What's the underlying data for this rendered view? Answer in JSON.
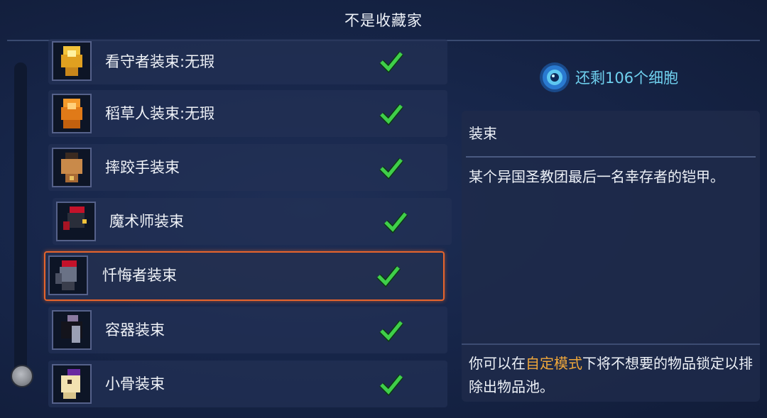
{
  "header": {
    "title": "不是收藏家"
  },
  "cells": {
    "label": "还剩106个细胞",
    "icon": "cell-orb-icon",
    "color": "#6fd0ee"
  },
  "items": [
    {
      "label": "看守者装束:无瑕",
      "icon": "gold-armor-outfit-icon",
      "checked": true
    },
    {
      "label": "稻草人装束:无瑕",
      "icon": "orange-armor-outfit-icon",
      "checked": true
    },
    {
      "label": "摔跤手装束",
      "icon": "wrestler-outfit-icon",
      "checked": true
    },
    {
      "label": "魔术师装束",
      "icon": "magician-outfit-icon",
      "checked": true
    },
    {
      "label": "忏悔者装束",
      "icon": "penitent-outfit-icon",
      "checked": true,
      "selected": true
    },
    {
      "label": "容器装束",
      "icon": "vessel-outfit-icon",
      "checked": true
    },
    {
      "label": "小骨装束",
      "icon": "little-bone-outfit-icon",
      "checked": true
    }
  ],
  "detail": {
    "category": "装束",
    "description": "某个异国圣教团最后一名幸存者的铠甲。",
    "hint_prefix": "你可以在",
    "hint_highlight": "自定模式",
    "hint_suffix": "下将不想要的物品锁定以排除出物品池。"
  },
  "colors": {
    "selected_border": "#e6642c",
    "check": "#3fcf4a",
    "highlight": "#f0a73a"
  }
}
